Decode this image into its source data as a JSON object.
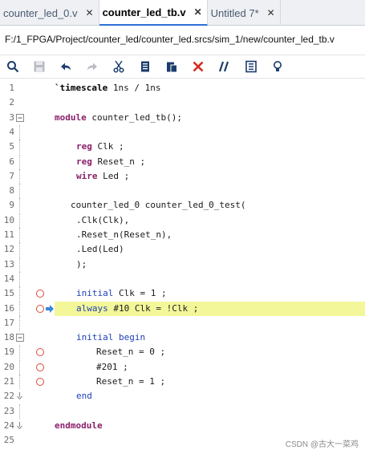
{
  "tabs": [
    {
      "label": "counter_led_0.v",
      "active": false
    },
    {
      "label": "counter_led_tb.v",
      "active": true
    },
    {
      "label": "Untitled 7*",
      "active": false
    }
  ],
  "path": "F:/1_FPGA/Project/counter_led/counter_led.srcs/sim_1/new/counter_led_tb.v",
  "toolbar": {
    "icons": [
      "search-icon",
      "save-icon",
      "undo-icon",
      "redo-icon",
      "cut-icon",
      "copy-icon",
      "paste-icon",
      "delete-icon",
      "comment-icon",
      "block-icon",
      "bulb-icon"
    ]
  },
  "lines": [
    {
      "n": "1",
      "parts": [
        {
          "t": "`timescale",
          "c": "dir"
        },
        {
          "t": " 1ns / 1ns",
          "c": ""
        }
      ]
    },
    {
      "n": "2",
      "parts": []
    },
    {
      "n": "3",
      "parts": [
        {
          "t": "module",
          "c": "kw"
        },
        {
          "t": " counter_led_tb();",
          "c": ""
        }
      ]
    },
    {
      "n": "4",
      "parts": []
    },
    {
      "n": "5",
      "parts": [
        {
          "t": "reg",
          "c": "kw"
        },
        {
          "t": " Clk ;",
          "c": ""
        }
      ]
    },
    {
      "n": "6",
      "parts": [
        {
          "t": "reg",
          "c": "kw"
        },
        {
          "t": " Reset_n ;",
          "c": ""
        }
      ]
    },
    {
      "n": "7",
      "parts": [
        {
          "t": "wire",
          "c": "kw"
        },
        {
          "t": " Led ;",
          "c": ""
        }
      ]
    },
    {
      "n": "8",
      "parts": []
    },
    {
      "n": "9",
      "parts": [
        {
          "t": "counter_led_0 counter_led_0_test(",
          "c": ""
        }
      ]
    },
    {
      "n": "10",
      "parts": [
        {
          "t": ".Clk(Clk),",
          "c": ""
        }
      ]
    },
    {
      "n": "11",
      "parts": [
        {
          "t": ".Reset_n(Reset_n),",
          "c": ""
        }
      ]
    },
    {
      "n": "12",
      "parts": [
        {
          "t": ".Led(Led)",
          "c": ""
        }
      ]
    },
    {
      "n": "13",
      "parts": [
        {
          "t": ");",
          "c": ""
        }
      ]
    },
    {
      "n": "14",
      "parts": []
    },
    {
      "n": "15",
      "parts": [
        {
          "t": "initial",
          "c": "kw2"
        },
        {
          "t": " Clk = 1 ;",
          "c": ""
        }
      ]
    },
    {
      "n": "16",
      "parts": [
        {
          "t": "always",
          "c": "kw2"
        },
        {
          "t": " #10 Clk = !Clk ;",
          "c": ""
        }
      ]
    },
    {
      "n": "17",
      "parts": []
    },
    {
      "n": "18",
      "parts": [
        {
          "t": "initial",
          "c": "kw2"
        },
        {
          "t": " ",
          "c": ""
        },
        {
          "t": "begin",
          "c": "kw2"
        }
      ]
    },
    {
      "n": "19",
      "parts": [
        {
          "t": "Reset_n = 0 ;",
          "c": ""
        }
      ]
    },
    {
      "n": "20",
      "parts": [
        {
          "t": "#201 ;",
          "c": ""
        }
      ]
    },
    {
      "n": "21",
      "parts": [
        {
          "t": "Reset_n = 1 ;",
          "c": ""
        }
      ]
    },
    {
      "n": "22",
      "parts": [
        {
          "t": "end",
          "c": "kw2"
        }
      ]
    },
    {
      "n": "23",
      "parts": []
    },
    {
      "n": "24",
      "parts": [
        {
          "t": "endmodule",
          "c": "kw"
        }
      ]
    },
    {
      "n": "25",
      "parts": []
    }
  ],
  "watermark": "CSDN @古大一菜鸡"
}
